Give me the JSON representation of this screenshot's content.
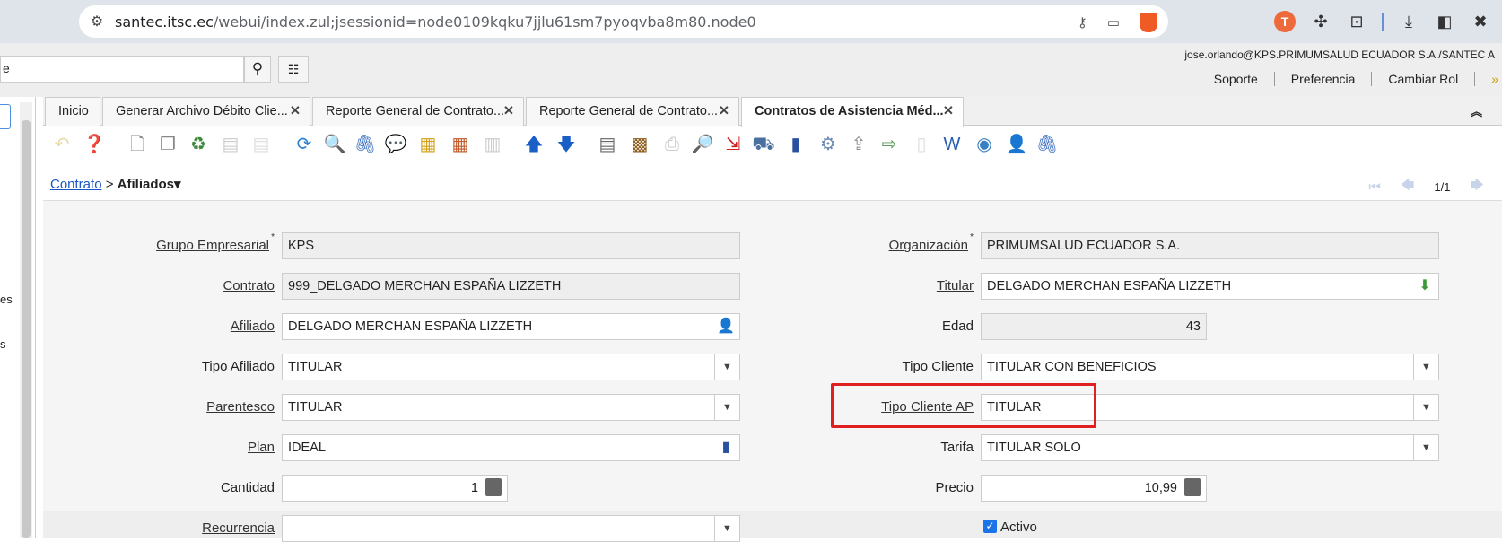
{
  "browser": {
    "url_host": "santec.itsc.ec",
    "url_path": "/webui/index.zul;jsessionid=node0109kqku7jjlu61sm7pyoqvba8m80.node0"
  },
  "app": {
    "search_value": "e",
    "user": "jose.orlando@KPS.PRIMUMSALUD ECUADOR S.A./SANTEC A",
    "links": [
      "Soporte",
      "Preferencia",
      "Cambiar Rol",
      "»"
    ],
    "left_panel": {
      "text1": "es",
      "text2": "s"
    }
  },
  "tabs": [
    {
      "label": "Inicio",
      "closable": false
    },
    {
      "label": "Generar Archivo Débito Clie...",
      "closable": true
    },
    {
      "label": "Reporte General de Contrato...",
      "closable": true
    },
    {
      "label": "Reporte General de Contrato...",
      "closable": true
    },
    {
      "label": "Contratos de Asistencia Méd...",
      "closable": true,
      "active": true
    }
  ],
  "breadcrumb": {
    "parent": "Contrato",
    "separator": ">",
    "current": "Afiliados"
  },
  "pager": "1/1",
  "form": {
    "grupo_empresarial": {
      "label": "Grupo Empresarial",
      "value": "KPS"
    },
    "organizacion": {
      "label": "Organización",
      "value": "PRIMUMSALUD ECUADOR S.A."
    },
    "contrato": {
      "label": "Contrato",
      "value": "999_DELGADO MERCHAN ESPAÑA LIZZETH"
    },
    "titular": {
      "label": "Titular",
      "value": "DELGADO MERCHAN ESPAÑA LIZZETH"
    },
    "afiliado": {
      "label": "Afiliado",
      "value": "DELGADO MERCHAN ESPAÑA LIZZETH"
    },
    "edad": {
      "label": "Edad",
      "value": "43"
    },
    "tipo_afiliado": {
      "label": "Tipo Afiliado",
      "value": "TITULAR"
    },
    "tipo_cliente": {
      "label": "Tipo Cliente",
      "value": "TITULAR CON BENEFICIOS"
    },
    "parentesco": {
      "label": "Parentesco",
      "value": "TITULAR"
    },
    "tipo_cliente_ap": {
      "label": "Tipo Cliente AP",
      "value": "TITULAR"
    },
    "plan": {
      "label": "Plan",
      "value": "IDEAL"
    },
    "tarifa": {
      "label": "Tarifa",
      "value": "TITULAR SOLO"
    },
    "cantidad": {
      "label": "Cantidad",
      "value": "1"
    },
    "precio": {
      "label": "Precio",
      "value": "10,99"
    },
    "recurrencia": {
      "label": "Recurrencia",
      "value": ""
    },
    "activo": {
      "label": "Activo",
      "checked": true
    }
  },
  "colors": {
    "accent": "#1a56c6",
    "highlight_border": "#e02020"
  }
}
